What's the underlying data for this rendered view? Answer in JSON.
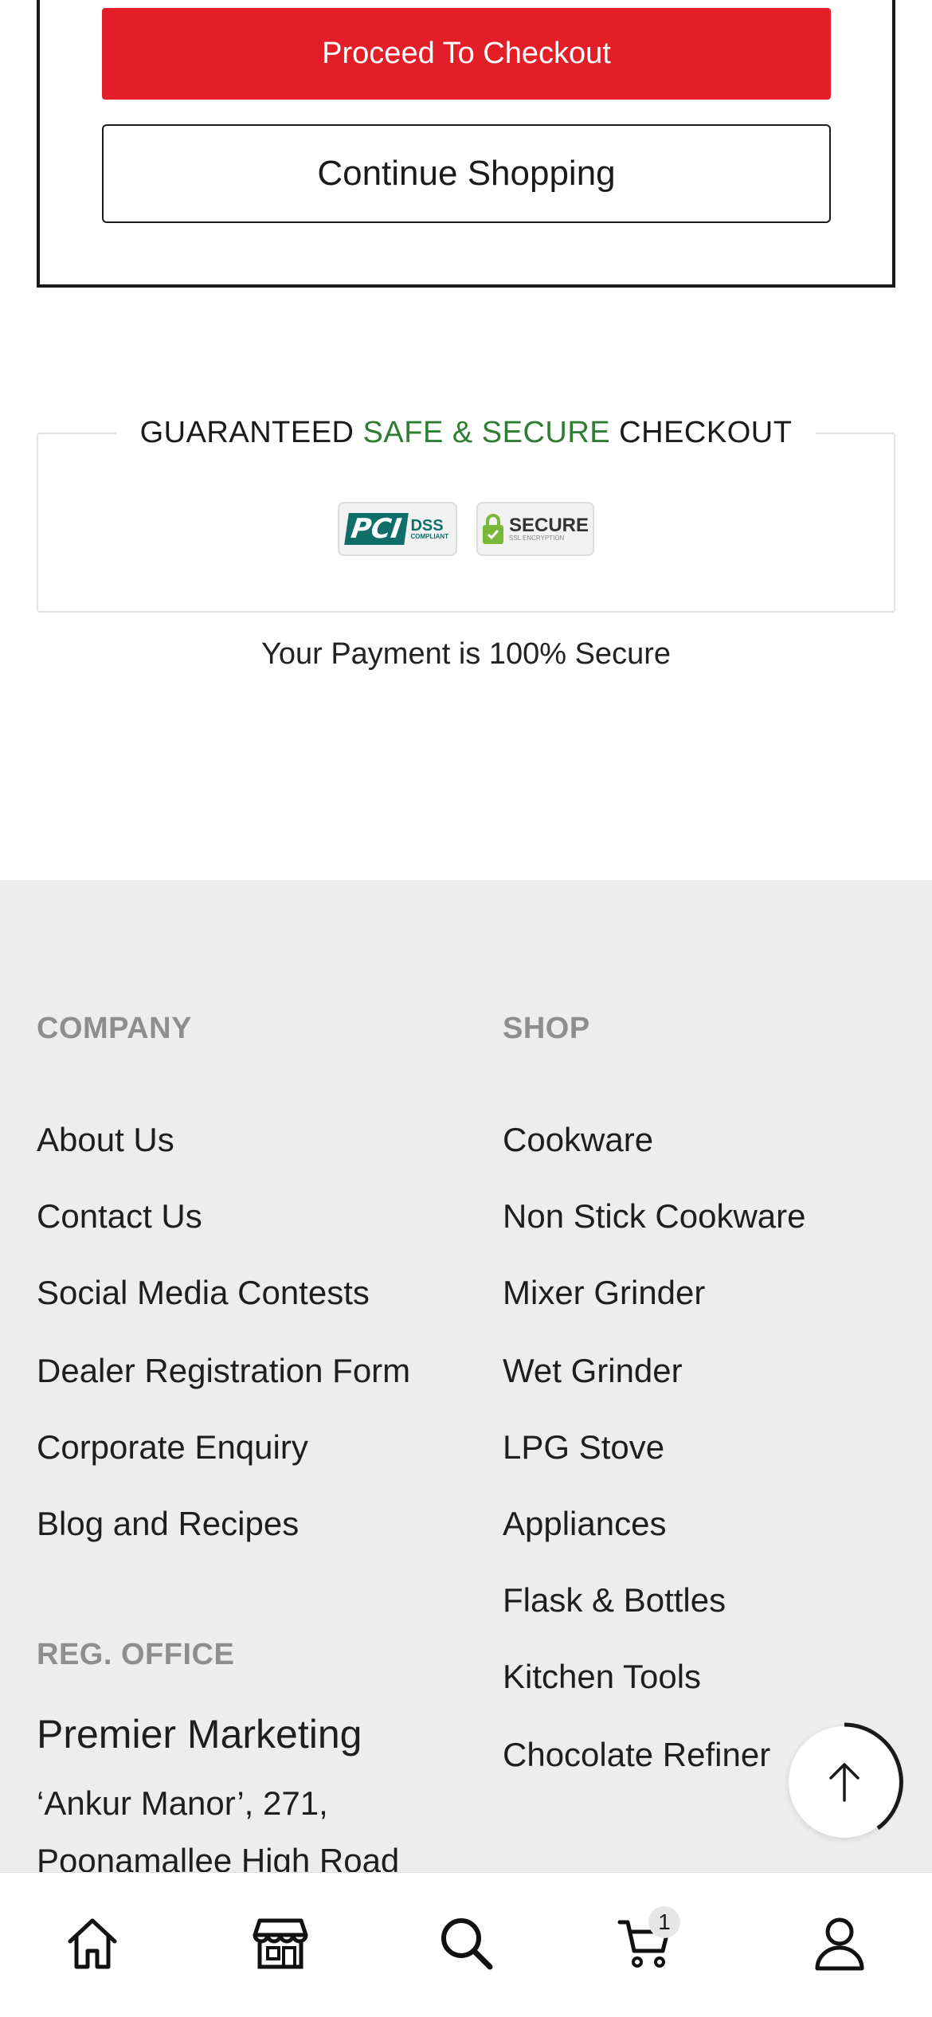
{
  "cart_summary": {
    "checkout_label": "Proceed To Checkout",
    "continue_label": "Continue Shopping"
  },
  "secure": {
    "title_part1": "GUARANTEED ",
    "title_part2": "SAFE & SECURE",
    "title_part3": " CHECKOUT",
    "pci_mark": "PCI",
    "pci_dss": "DSS",
    "pci_sub": "COMPLIANT",
    "ssl_main": "SECURE",
    "ssl_sub": "SSL ENCRYPTION",
    "note": "Your Payment is 100% Secure",
    "accent_color": "#2e7d32"
  },
  "footer": {
    "company_heading": "COMPANY",
    "company_links": [
      "About Us",
      "Contact Us",
      "Social Media Contests",
      "Dealer Registration Form",
      "Corporate Enquiry",
      "Blog and Recipes"
    ],
    "shop_heading": "SHOP",
    "shop_links": [
      "Cookware",
      "Non Stick Cookware",
      "Mixer Grinder",
      "Wet Grinder",
      "LPG Stove",
      "Appliances",
      "Flask & Bottles",
      "Kitchen Tools",
      "Chocolate Refiner"
    ],
    "office_heading": "REG. OFFICE",
    "office_name": "Premier Marketing",
    "office_line1": "‘Ankur Manor’, 271,",
    "office_line2": "Poonamallee High Road"
  },
  "bottom_nav": {
    "items": [
      "home-icon",
      "store-icon",
      "search-icon",
      "cart-icon",
      "account-icon"
    ],
    "cart_count": "1"
  },
  "colors": {
    "brand_red": "#e31e26",
    "footer_bg": "#ededed"
  }
}
